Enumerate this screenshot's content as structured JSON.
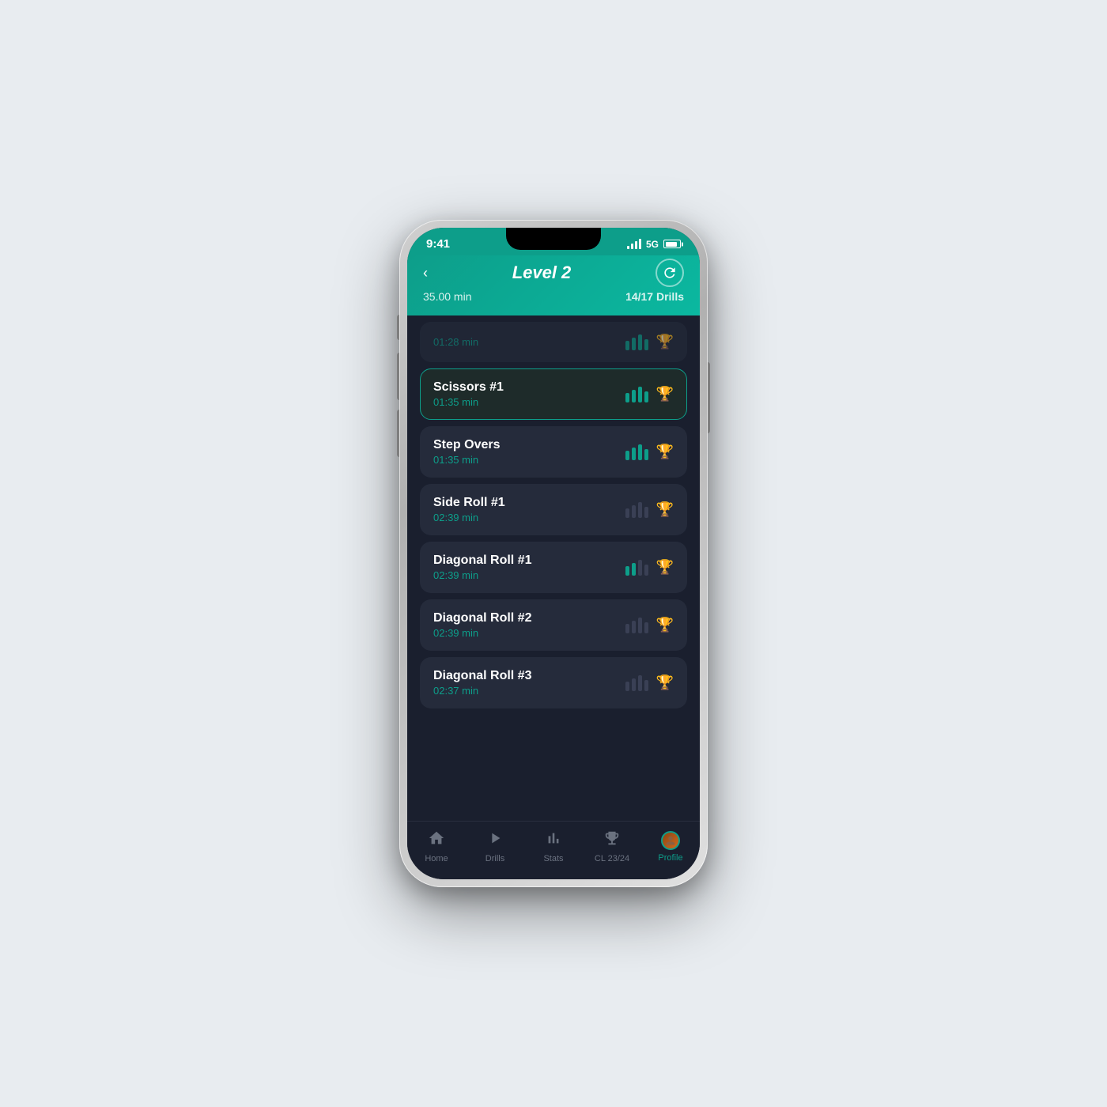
{
  "status_bar": {
    "time": "9:41",
    "signal_label": "5G"
  },
  "header": {
    "back_label": "‹",
    "title": "Level 2",
    "time_label": "35.00 min",
    "drills_label": "14/17 Drills"
  },
  "drills": [
    {
      "id": "partial-top",
      "name": "",
      "duration": "01:28 min",
      "partial": true,
      "active": false,
      "progress": 4,
      "trophy_earned": true
    },
    {
      "id": "scissors-1",
      "name": "Scissors #1",
      "duration": "01:35 min",
      "partial": false,
      "active": true,
      "progress": 4,
      "trophy_earned": true
    },
    {
      "id": "step-overs",
      "name": "Step Overs",
      "duration": "01:35 min",
      "partial": false,
      "active": false,
      "progress": 4,
      "trophy_earned": false
    },
    {
      "id": "side-roll-1",
      "name": "Side Roll #1",
      "duration": "02:39 min",
      "partial": false,
      "active": false,
      "progress": 0,
      "trophy_earned": false
    },
    {
      "id": "diagonal-roll-1",
      "name": "Diagonal Roll #1",
      "duration": "02:39 min",
      "partial": false,
      "active": false,
      "progress": 2,
      "trophy_earned": false
    },
    {
      "id": "diagonal-roll-2",
      "name": "Diagonal Roll #2",
      "duration": "02:39 min",
      "partial": false,
      "active": false,
      "progress": 0,
      "trophy_earned": false
    },
    {
      "id": "diagonal-roll-3",
      "name": "Diagonal Roll #3",
      "duration": "02:37 min",
      "partial": false,
      "active": false,
      "progress": 0,
      "trophy_earned": false
    }
  ],
  "bottom_nav": {
    "items": [
      {
        "id": "home",
        "label": "Home",
        "icon": "🏠",
        "active": false
      },
      {
        "id": "drills",
        "label": "Drills",
        "icon": "▶",
        "active": false
      },
      {
        "id": "stats",
        "label": "Stats",
        "icon": "📊",
        "active": false
      },
      {
        "id": "cl",
        "label": "CL 23/24",
        "icon": "🏆",
        "active": false
      },
      {
        "id": "profile",
        "label": "Profile",
        "icon": "👤",
        "active": true
      }
    ]
  }
}
